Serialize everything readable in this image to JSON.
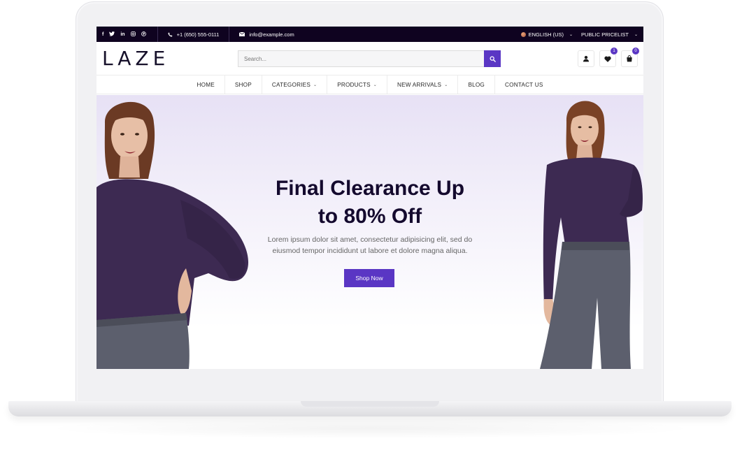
{
  "topbar": {
    "social_icons": [
      "facebook-icon",
      "twitter-icon",
      "linkedin-icon",
      "instagram-icon",
      "pinterest-icon"
    ],
    "social_glyphs": [
      "f",
      "t",
      "in",
      "ig",
      "p"
    ],
    "phone": "+1 (650) 555-0111",
    "email": "info@example.com",
    "language": "ENGLISH (US)",
    "pricelist": "PUBLIC PRICELIST"
  },
  "header": {
    "logo": "LAZE",
    "search_placeholder": "Search...",
    "wishlist_count": "1",
    "cart_count": "0"
  },
  "nav": {
    "items": [
      {
        "label": "HOME"
      },
      {
        "label": "SHOP"
      },
      {
        "label": "CATEGORIES"
      },
      {
        "label": "PRODUCTS"
      },
      {
        "label": "NEW ARRIVALS"
      },
      {
        "label": "BLOG"
      },
      {
        "label": "CONTACT US"
      }
    ]
  },
  "hero": {
    "title_line1": "Final Clearance Up",
    "title_line2": "to 80% Off",
    "subtitle_line1": "Lorem ipsum dolor sit amet, consectetur adipisicing elit, sed do",
    "subtitle_line2": "eiusmod tempor incididunt ut labore et dolore magna aliqua.",
    "button": "Shop Now"
  },
  "colors": {
    "topbar_bg": "#0f0320",
    "accent": "#5a36c4",
    "title": "#140a2e",
    "top_garment": "#3d2a52",
    "pants": "#5c5f6d"
  }
}
